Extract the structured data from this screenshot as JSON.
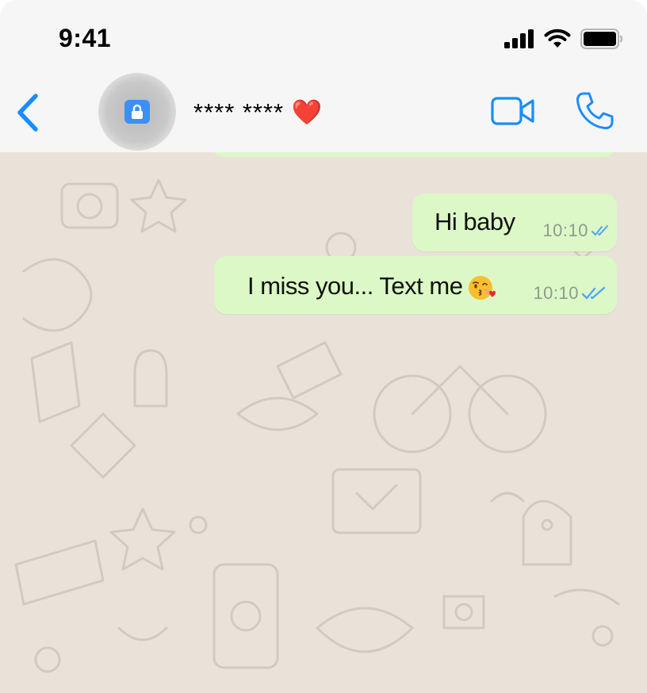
{
  "status_bar": {
    "time": "9:41"
  },
  "header": {
    "contact_name": "**** **** ❤️",
    "icons": {
      "back": "chevron-left-icon",
      "lock": "lock-icon",
      "video": "video-camera-icon",
      "call": "phone-icon"
    },
    "accent_color": "#1a8cff"
  },
  "messages": [
    {
      "text": "Hi baby",
      "time": "10:10",
      "status": "read"
    },
    {
      "text": "I miss you... Text me",
      "emoji": "kissing-face-with-heart-icon",
      "time": "10:10",
      "status": "read"
    }
  ],
  "colors": {
    "outgoing_bubble": "#dcf8c6",
    "chat_background": "#e9e2d9",
    "read_ticks": "#4fa8f0"
  }
}
